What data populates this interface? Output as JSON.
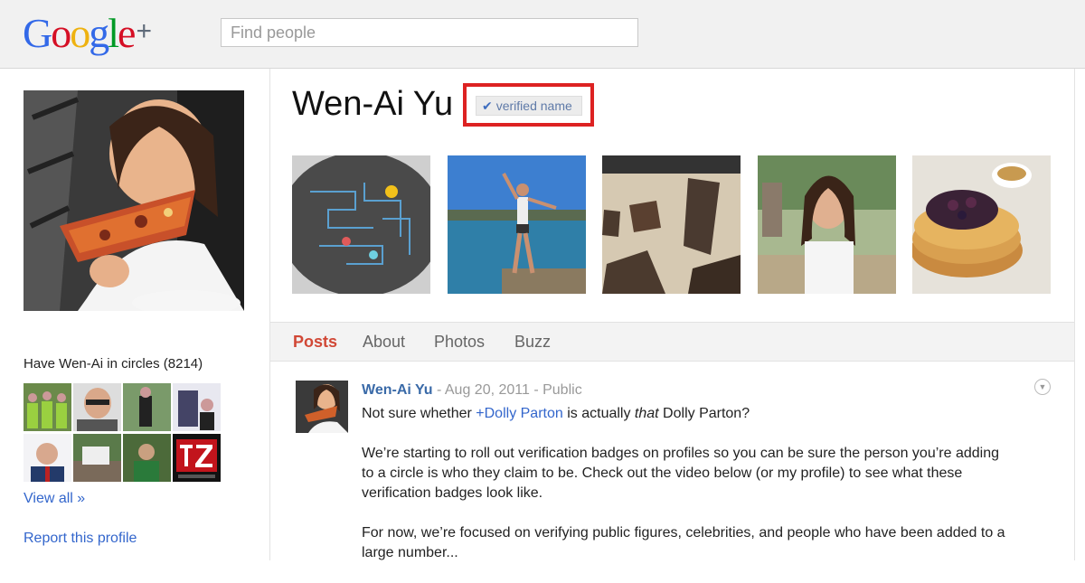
{
  "header": {
    "logo": {
      "g1": "G",
      "o1": "o",
      "o2": "o",
      "g2": "g",
      "l": "l",
      "e": "e",
      "plus": "+"
    },
    "search_placeholder": "Find people"
  },
  "sidebar": {
    "circles_title": "Have Wen-Ai in circles (8214)",
    "view_all": "View all »",
    "report": "Report this profile"
  },
  "profile": {
    "name": "Wen-Ai Yu",
    "verified_label": "verified name",
    "check_icon": "✔"
  },
  "tabs": [
    "Posts",
    "About",
    "Photos",
    "Buzz"
  ],
  "post": {
    "author": "Wen-Ai Yu",
    "sep1": " - ",
    "date": "Aug 20, 2011",
    "sep2": " - ",
    "visibility": "Public",
    "line1_pre": "Not sure whether ",
    "mention": "+Dolly Parton",
    "line1_mid": " is actually ",
    "line1_em": "that",
    "line1_post": " Dolly Parton?",
    "para2": "We’re starting to roll out verification badges on profiles so you can be sure the person you’re adding to a circle is who they claim to be. Check out the video below (or my profile) to see what these verification badges look like.",
    "para3": "For now, we’re focused on verifying public figures, celebrities, and people who have been added to a large number..."
  },
  "colors": {
    "accent_red": "#dd2222",
    "link_blue": "#3366cc",
    "active_tab": "#d14836"
  }
}
